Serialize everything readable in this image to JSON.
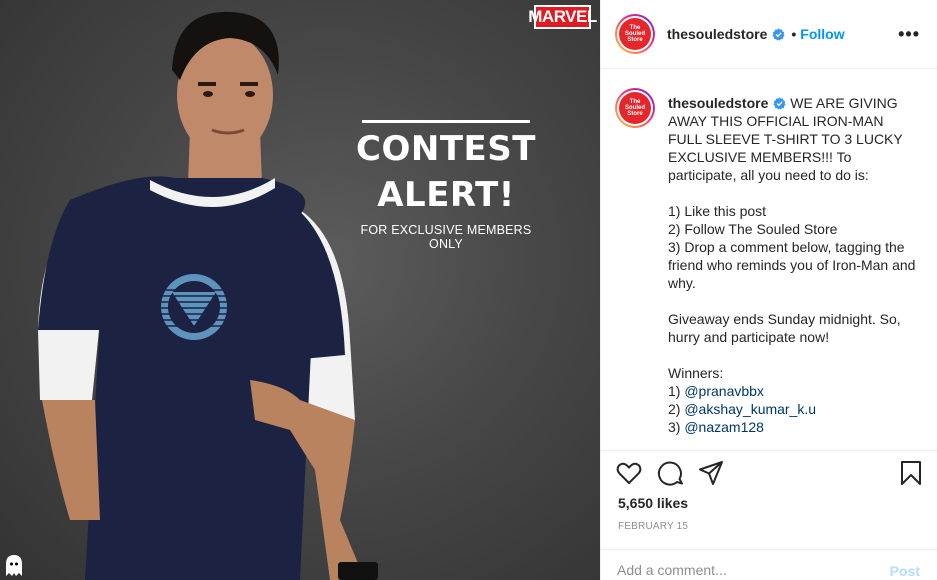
{
  "photo": {
    "brand_logo": "MARVEL",
    "headline_line1": "CONTEST",
    "headline_line2": "ALERT!",
    "subheadline": "FOR EXCLUSIVE MEMBERS ONLY",
    "icons": [
      "ghost-icon"
    ]
  },
  "header": {
    "username": "thesouledstore",
    "separator": "•",
    "follow_label": "Follow",
    "more_label": "•••",
    "avatar_text": "The Souled Store"
  },
  "caption": {
    "username": "thesouledstore",
    "intro": "WE ARE GIVING AWAY THIS OFFICIAL IRON-MAN FULL SLEEVE T-SHIRT TO 3 LUCKY EXCLUSIVE MEMBERS!!! To participate, all you need to do is:",
    "step1": "1) Like this post",
    "step2": "2) Follow The Souled Store",
    "step3": "3) Drop a comment below, tagging the friend who reminds you of Iron-Man and why.",
    "giveaway": "Giveaway ends Sunday midnight. So, hurry and participate now!",
    "winners_label": "Winners:",
    "winners": [
      {
        "prefix": "1) ",
        "handle": "@pranavbbx"
      },
      {
        "prefix": "2) ",
        "handle": "@akshay_kumar_k.u"
      },
      {
        "prefix": "3) ",
        "handle": "@nazam128"
      }
    ]
  },
  "actions": {
    "icons": [
      "heart-icon",
      "comment-icon",
      "share-icon",
      "bookmark-icon"
    ],
    "likes": "5,650 likes",
    "date": "FEBRUARY 15"
  },
  "comment": {
    "placeholder": "Add a comment...",
    "post_label": "Post"
  },
  "colors": {
    "accent": "#0095f6",
    "brand_red": "#e7262b",
    "mention": "#00376b",
    "post_disabled": "#b2dffc"
  }
}
